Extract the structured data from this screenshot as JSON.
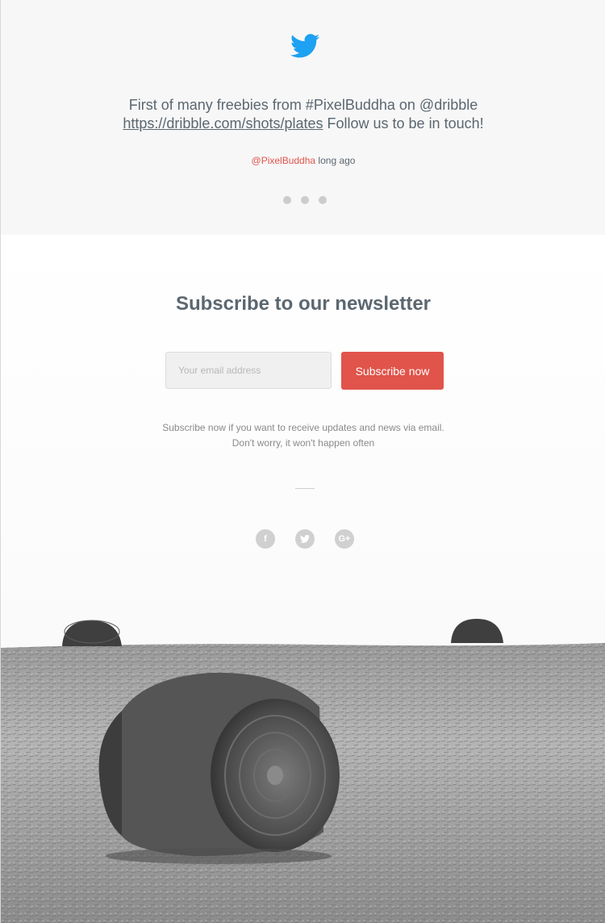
{
  "tweet": {
    "line1": "First of many freebies from #PixelBuddha on @dribble",
    "link": "https://dribble.com/shots/plates",
    "line2_rest": " Follow us to be in touch!",
    "handle": "@PixelBuddha",
    "time": " long ago",
    "icon": "twitter-bird-icon",
    "accent_color": "#1da1f2"
  },
  "newsletter": {
    "title": "Subscribe to our newsletter",
    "email_placeholder": "Your email address",
    "subscribe_label": "Subscribe now",
    "note_line1": "Subscribe now if you want to receive updates and news via email.",
    "note_line2": "Don't worry, it won't happen often",
    "button_color": "#e0544b"
  },
  "social": {
    "facebook_glyph": "f",
    "google_glyph": "G+",
    "icons": [
      "facebook-icon",
      "twitter-icon",
      "google-plus-icon"
    ]
  }
}
